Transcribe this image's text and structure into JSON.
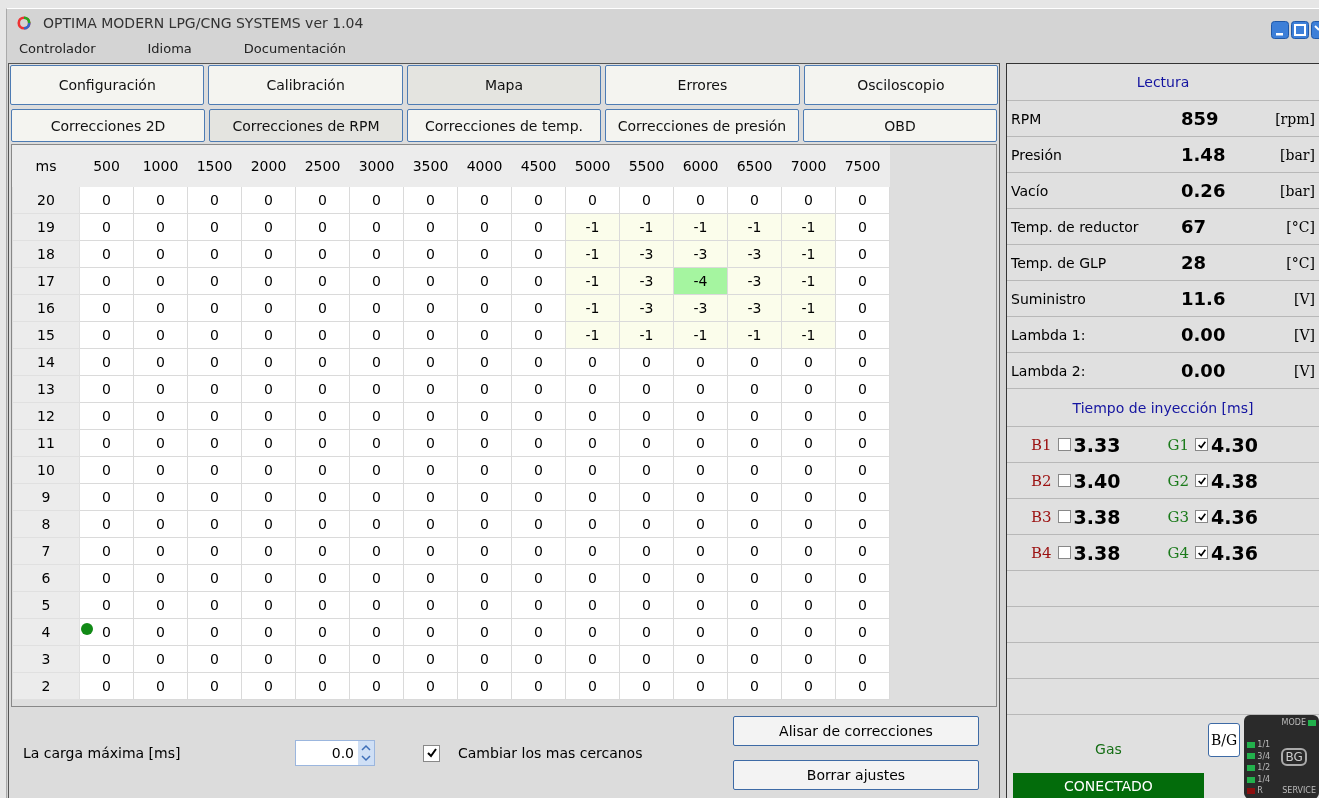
{
  "window": {
    "title": "OPTIMA MODERN LPG/CNG SYSTEMS ver 1.04"
  },
  "menu": [
    "Controlador",
    "Idioma",
    "Documentación"
  ],
  "tabs": [
    {
      "label": "Configuración",
      "selected": false
    },
    {
      "label": "Calibración",
      "selected": false
    },
    {
      "label": "Mapa",
      "selected": true
    },
    {
      "label": "Errores",
      "selected": false
    },
    {
      "label": "Osciloscopio",
      "selected": false
    }
  ],
  "subtabs": [
    {
      "label": "Correcciones 2D",
      "selected": false
    },
    {
      "label": "Correcciones de RPM",
      "selected": true
    },
    {
      "label": "Correcciones de temp.",
      "selected": false
    },
    {
      "label": "Correcciones de presión",
      "selected": false
    },
    {
      "label": "OBD",
      "selected": false
    }
  ],
  "table": {
    "corner": "ms",
    "columns": [
      "500",
      "1000",
      "1500",
      "2000",
      "2500",
      "3000",
      "3500",
      "4000",
      "4500",
      "5000",
      "5500",
      "6000",
      "6500",
      "7000",
      "7500"
    ],
    "rows": [
      {
        "label": "20",
        "cells": [
          "0",
          "0",
          "0",
          "0",
          "0",
          "0",
          "0",
          "0",
          "0",
          "0",
          "0",
          "0",
          "0",
          "0",
          "0"
        ]
      },
      {
        "label": "19",
        "cells": [
          "0",
          "0",
          "0",
          "0",
          "0",
          "0",
          "0",
          "0",
          "0",
          "-1",
          "-1",
          "-1",
          "-1",
          "-1",
          "0"
        ]
      },
      {
        "label": "18",
        "cells": [
          "0",
          "0",
          "0",
          "0",
          "0",
          "0",
          "0",
          "0",
          "0",
          "-1",
          "-3",
          "-3",
          "-3",
          "-1",
          "0"
        ]
      },
      {
        "label": "17",
        "cells": [
          "0",
          "0",
          "0",
          "0",
          "0",
          "0",
          "0",
          "0",
          "0",
          "-1",
          "-3",
          {
            "value": "-4",
            "selected": true
          },
          "-3",
          "-1",
          "0"
        ]
      },
      {
        "label": "16",
        "cells": [
          "0",
          "0",
          "0",
          "0",
          "0",
          "0",
          "0",
          "0",
          "0",
          "-1",
          "-3",
          "-3",
          "-3",
          "-1",
          "0"
        ]
      },
      {
        "label": "15",
        "cells": [
          "0",
          "0",
          "0",
          "0",
          "0",
          "0",
          "0",
          "0",
          "0",
          "-1",
          "-1",
          "-1",
          "-1",
          "-1",
          "0"
        ]
      },
      {
        "label": "14",
        "cells": [
          "0",
          "0",
          "0",
          "0",
          "0",
          "0",
          "0",
          "0",
          "0",
          "0",
          "0",
          "0",
          "0",
          "0",
          "0"
        ]
      },
      {
        "label": "13",
        "cells": [
          "0",
          "0",
          "0",
          "0",
          "0",
          "0",
          "0",
          "0",
          "0",
          "0",
          "0",
          "0",
          "0",
          "0",
          "0"
        ]
      },
      {
        "label": "12",
        "cells": [
          "0",
          "0",
          "0",
          "0",
          "0",
          "0",
          "0",
          "0",
          "0",
          "0",
          "0",
          "0",
          "0",
          "0",
          "0"
        ]
      },
      {
        "label": "11",
        "cells": [
          "0",
          "0",
          "0",
          "0",
          "0",
          "0",
          "0",
          "0",
          "0",
          "0",
          "0",
          "0",
          "0",
          "0",
          "0"
        ]
      },
      {
        "label": "10",
        "cells": [
          "0",
          "0",
          "0",
          "0",
          "0",
          "0",
          "0",
          "0",
          "0",
          "0",
          "0",
          "0",
          "0",
          "0",
          "0"
        ]
      },
      {
        "label": "9",
        "cells": [
          "0",
          "0",
          "0",
          "0",
          "0",
          "0",
          "0",
          "0",
          "0",
          "0",
          "0",
          "0",
          "0",
          "0",
          "0"
        ]
      },
      {
        "label": "8",
        "cells": [
          "0",
          "0",
          "0",
          "0",
          "0",
          "0",
          "0",
          "0",
          "0",
          "0",
          "0",
          "0",
          "0",
          "0",
          "0"
        ]
      },
      {
        "label": "7",
        "cells": [
          "0",
          "0",
          "0",
          "0",
          "0",
          "0",
          "0",
          "0",
          "0",
          "0",
          "0",
          "0",
          "0",
          "0",
          "0"
        ]
      },
      {
        "label": "6",
        "cells": [
          "0",
          "0",
          "0",
          "0",
          "0",
          "0",
          "0",
          "0",
          "0",
          "0",
          "0",
          "0",
          "0",
          "0",
          "0"
        ]
      },
      {
        "label": "5",
        "cells": [
          "0",
          "0",
          "0",
          "0",
          "0",
          "0",
          "0",
          "0",
          "0",
          "0",
          "0",
          "0",
          "0",
          "0",
          "0"
        ]
      },
      {
        "label": "4",
        "cells": [
          {
            "value": "0",
            "current": true
          },
          "0",
          "0",
          "0",
          "0",
          "0",
          "0",
          "0",
          "0",
          "0",
          "0",
          "0",
          "0",
          "0",
          "0"
        ]
      },
      {
        "label": "3",
        "cells": [
          "0",
          "0",
          "0",
          "0",
          "0",
          "0",
          "0",
          "0",
          "0",
          "0",
          "0",
          "0",
          "0",
          "0",
          "0"
        ]
      },
      {
        "label": "2",
        "cells": [
          "0",
          "0",
          "0",
          "0",
          "0",
          "0",
          "0",
          "0",
          "0",
          "0",
          "0",
          "0",
          "0",
          "0",
          "0"
        ]
      }
    ]
  },
  "bottom": {
    "max_load_label": "La carga máxima [ms]",
    "max_load_value": "0.0",
    "nearest": {
      "label": "Cambiar los mas cercanos",
      "checked": true
    },
    "buttons": [
      "Alisar de correcciones",
      "Borrar ajustes"
    ]
  },
  "reading": {
    "title": "Lectura",
    "items": [
      {
        "label": "RPM",
        "value": "859",
        "unit": "[rpm]"
      },
      {
        "label": "Presión",
        "value": "1.48",
        "unit": "[bar]"
      },
      {
        "label": "Vacío",
        "value": "0.26",
        "unit": "[bar]"
      },
      {
        "label": "Temp. de reductor",
        "value": "67",
        "unit": "[°C]"
      },
      {
        "label": "Temp. de GLP",
        "value": "28",
        "unit": "[°C]"
      },
      {
        "label": "Suministro",
        "value": "11.6",
        "unit": "[V]"
      },
      {
        "label": "Lambda 1:",
        "value": "0.00",
        "unit": "[V]"
      },
      {
        "label": "Lambda 2:",
        "value": "0.00",
        "unit": "[V]"
      }
    ]
  },
  "injection": {
    "title": "Tiempo de inyección [ms]",
    "rows": [
      {
        "petrol": {
          "label": "B1",
          "checked": false,
          "value": "3.33"
        },
        "gas": {
          "label": "G1",
          "checked": true,
          "value": "4.30"
        }
      },
      {
        "petrol": {
          "label": "B2",
          "checked": false,
          "value": "3.40"
        },
        "gas": {
          "label": "G2",
          "checked": true,
          "value": "4.38"
        }
      },
      {
        "petrol": {
          "label": "B3",
          "checked": false,
          "value": "3.38"
        },
        "gas": {
          "label": "G3",
          "checked": true,
          "value": "4.36"
        }
      },
      {
        "petrol": {
          "label": "B4",
          "checked": false,
          "value": "3.38"
        },
        "gas": {
          "label": "G4",
          "checked": true,
          "value": "4.36"
        }
      }
    ]
  },
  "status": {
    "fuel": "Gas",
    "switch_button": "B/G",
    "connection": "CONECTADO"
  },
  "switch_panel": {
    "logo": "BG",
    "service": "SERVICE",
    "leds": [
      {
        "kind": "mode",
        "label": "MODE",
        "color": "#22b14c"
      },
      {
        "kind": "level",
        "label": "1/1",
        "color": "#22b14c"
      },
      {
        "kind": "level",
        "label": "3/4",
        "color": "#22b14c"
      },
      {
        "kind": "level",
        "label": "1/2",
        "color": "#22b14c"
      },
      {
        "kind": "level",
        "label": "1/4",
        "color": "#22b14c"
      },
      {
        "kind": "level",
        "label": "R",
        "color": "#8b0e0e"
      }
    ]
  }
}
